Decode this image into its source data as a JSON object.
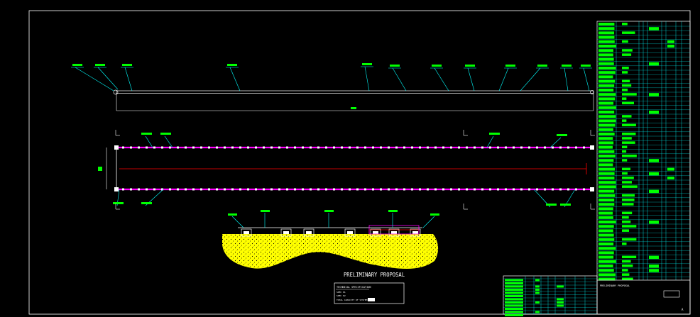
{
  "title": {
    "proposal": "PRELIMINARY PROPOSAL"
  },
  "colors": {
    "background": "#000000",
    "frame": "#ffffff",
    "leader": "#00ffff",
    "annotation": "#00ff00",
    "chain": "#ff00ff",
    "centerline": "#ff0000",
    "ground": "#ffff00"
  },
  "legend_box": {
    "heading": "TECHNICAL SPECIFICATION",
    "rows": [
      "SPEC 01",
      "SPEC 02",
      "TOTAL CAPACITY OF SYSTEM"
    ]
  },
  "title_block": {
    "project": "PRELIMINARY PROPOSAL",
    "sheet": "A"
  }
}
